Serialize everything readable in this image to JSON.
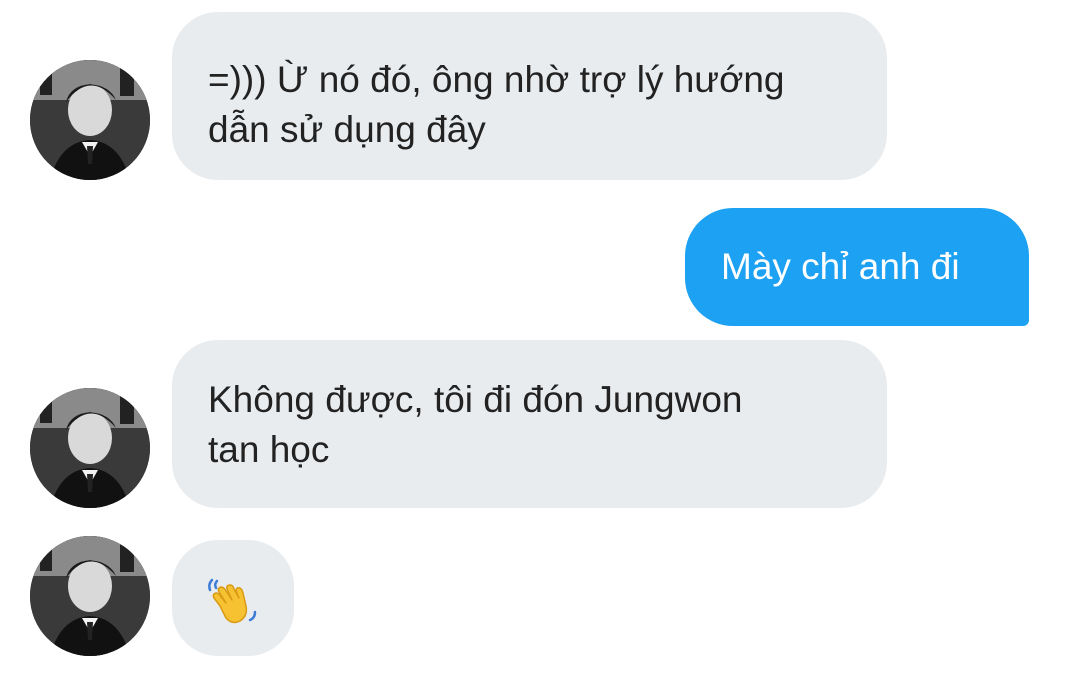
{
  "conversation": {
    "messages": [
      {
        "direction": "incoming",
        "lines": [
          "=))) Ừ nó đó, ông nhờ trợ lý hướng",
          "dẫn sử dụng đây"
        ]
      },
      {
        "direction": "outgoing",
        "lines": [
          "Mày chỉ anh đi"
        ]
      },
      {
        "direction": "incoming",
        "lines": [
          "Không được, tôi đi đón Jungwon",
          "tan học"
        ]
      },
      {
        "direction": "incoming",
        "emoji": "waving-hand"
      }
    ]
  },
  "colors": {
    "incoming_bubble": "#e9ecef",
    "outgoing_bubble": "#1da1f2",
    "incoming_text": "#222222",
    "outgoing_text": "#ffffff"
  }
}
